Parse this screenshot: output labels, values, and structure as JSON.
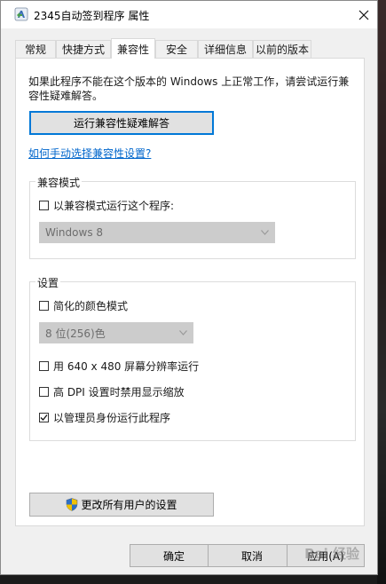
{
  "window": {
    "title": "2345自动签到程序 属性"
  },
  "tabs": [
    {
      "label": "常规"
    },
    {
      "label": "快捷方式"
    },
    {
      "label": "兼容性",
      "active": true
    },
    {
      "label": "安全"
    },
    {
      "label": "详细信息"
    },
    {
      "label": "以前的版本"
    }
  ],
  "compat": {
    "intro_line1": "如果此程序不能在这个版本的 Windows 上正常工作，请尝试运行兼",
    "intro_line2": "容性疑难解答。",
    "troubleshoot_button": "运行兼容性疑难解答",
    "manual_link": "如何手动选择兼容性设置?",
    "mode_group_label": "兼容模式",
    "mode_checkbox_label": "以兼容模式运行这个程序:",
    "mode_checked": false,
    "mode_select_value": "Windows 8",
    "settings_group_label": "设置",
    "settings": {
      "reduced_color_label": "简化的颜色模式",
      "reduced_color_checked": false,
      "color_select_value": "8 位(256)色",
      "res_640_label": "用 640 x 480 屏幕分辨率运行",
      "res_640_checked": false,
      "dpi_label": "高 DPI 设置时禁用显示缩放",
      "dpi_checked": false,
      "admin_label": "以管理员身份运行此程序",
      "admin_checked": true
    },
    "all_users_button": "更改所有用户的设置"
  },
  "footer": {
    "ok": "确定",
    "cancel": "取消",
    "apply": "应用(A)"
  },
  "watermark": "Bai 经验",
  "colors": {
    "accent": "#0078d7",
    "link": "#0066cc",
    "disabled_fill": "#cccccc"
  },
  "icons": {
    "app": "program-shortcut-icon",
    "close": "close-icon",
    "shield": "uac-shield-icon"
  }
}
